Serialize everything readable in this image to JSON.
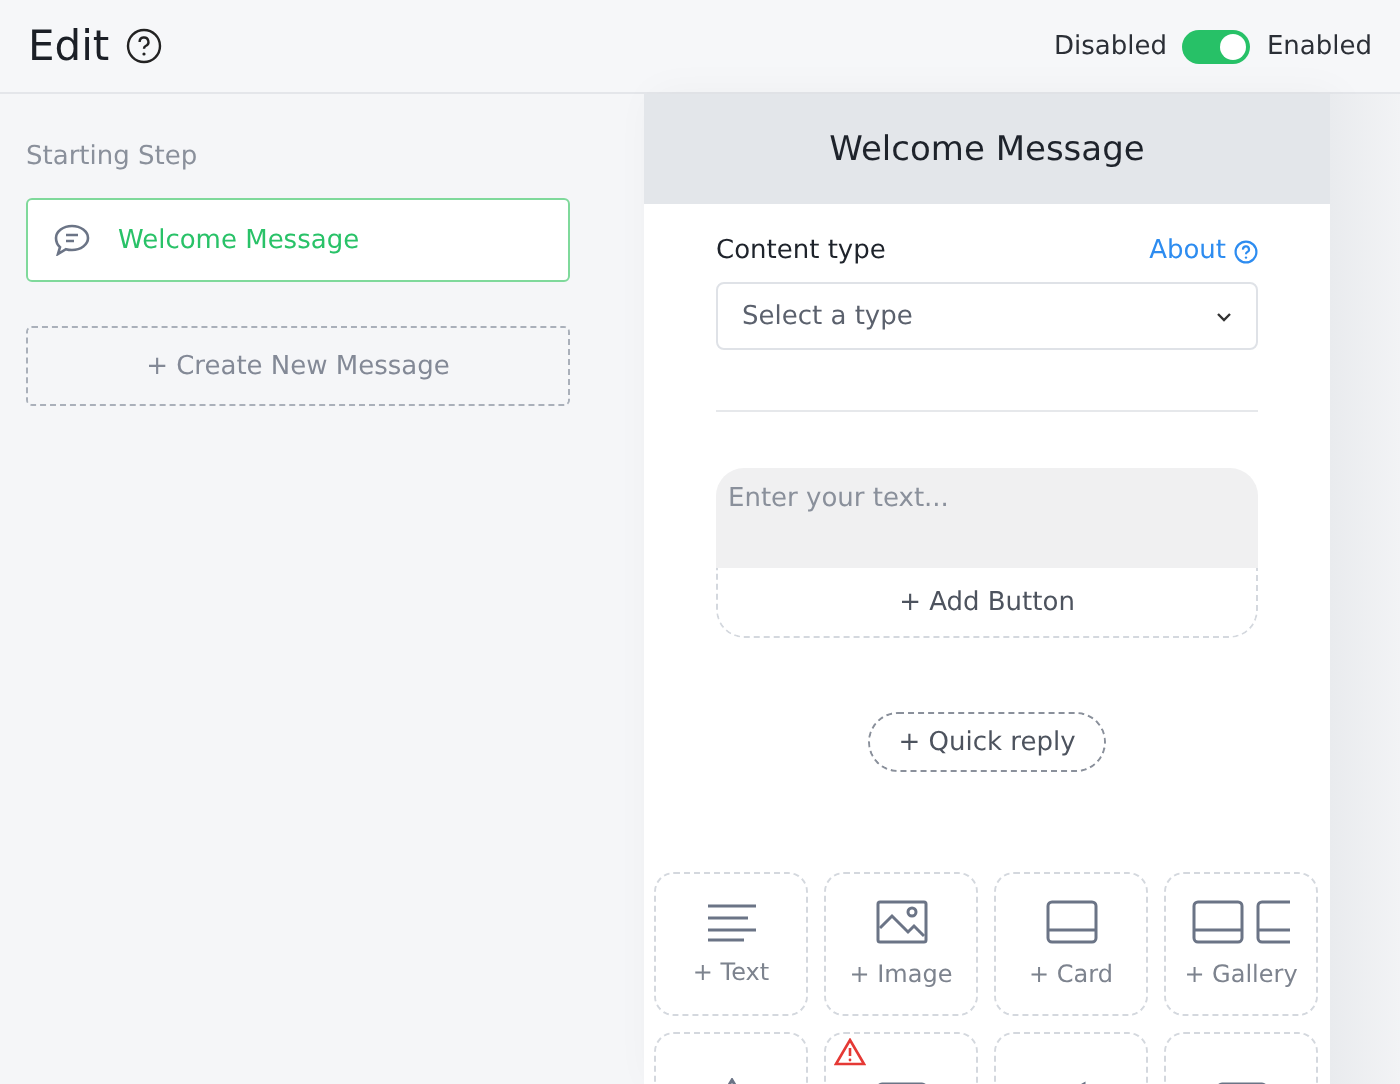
{
  "header": {
    "title": "Edit",
    "toggle": {
      "off_label": "Disabled",
      "on_label": "Enabled",
      "on": true
    }
  },
  "sidebar": {
    "heading": "Starting Step",
    "steps": [
      {
        "label": "Welcome Message",
        "selected": true
      }
    ],
    "create_button": "+ Create New Message"
  },
  "editor": {
    "title": "Welcome Message",
    "content_type_label": "Content type",
    "about_link": "About",
    "select": {
      "placeholder": "Select a type"
    },
    "text_field": {
      "placeholder": "Enter your text..."
    },
    "add_button": "+ Add Button",
    "quick_reply": "+ Quick reply",
    "tiles": [
      {
        "kind": "text",
        "label": "+ Text",
        "warning": false
      },
      {
        "kind": "image",
        "label": "+ Image",
        "warning": false
      },
      {
        "kind": "card",
        "label": "+ Card",
        "warning": false
      },
      {
        "kind": "gallery",
        "label": "+ Gallery",
        "warning": false
      },
      {
        "kind": "drop",
        "warning": false
      },
      {
        "kind": "table",
        "warning": true
      },
      {
        "kind": "megaphone",
        "warning": false
      },
      {
        "kind": "video",
        "warning": false
      }
    ]
  }
}
